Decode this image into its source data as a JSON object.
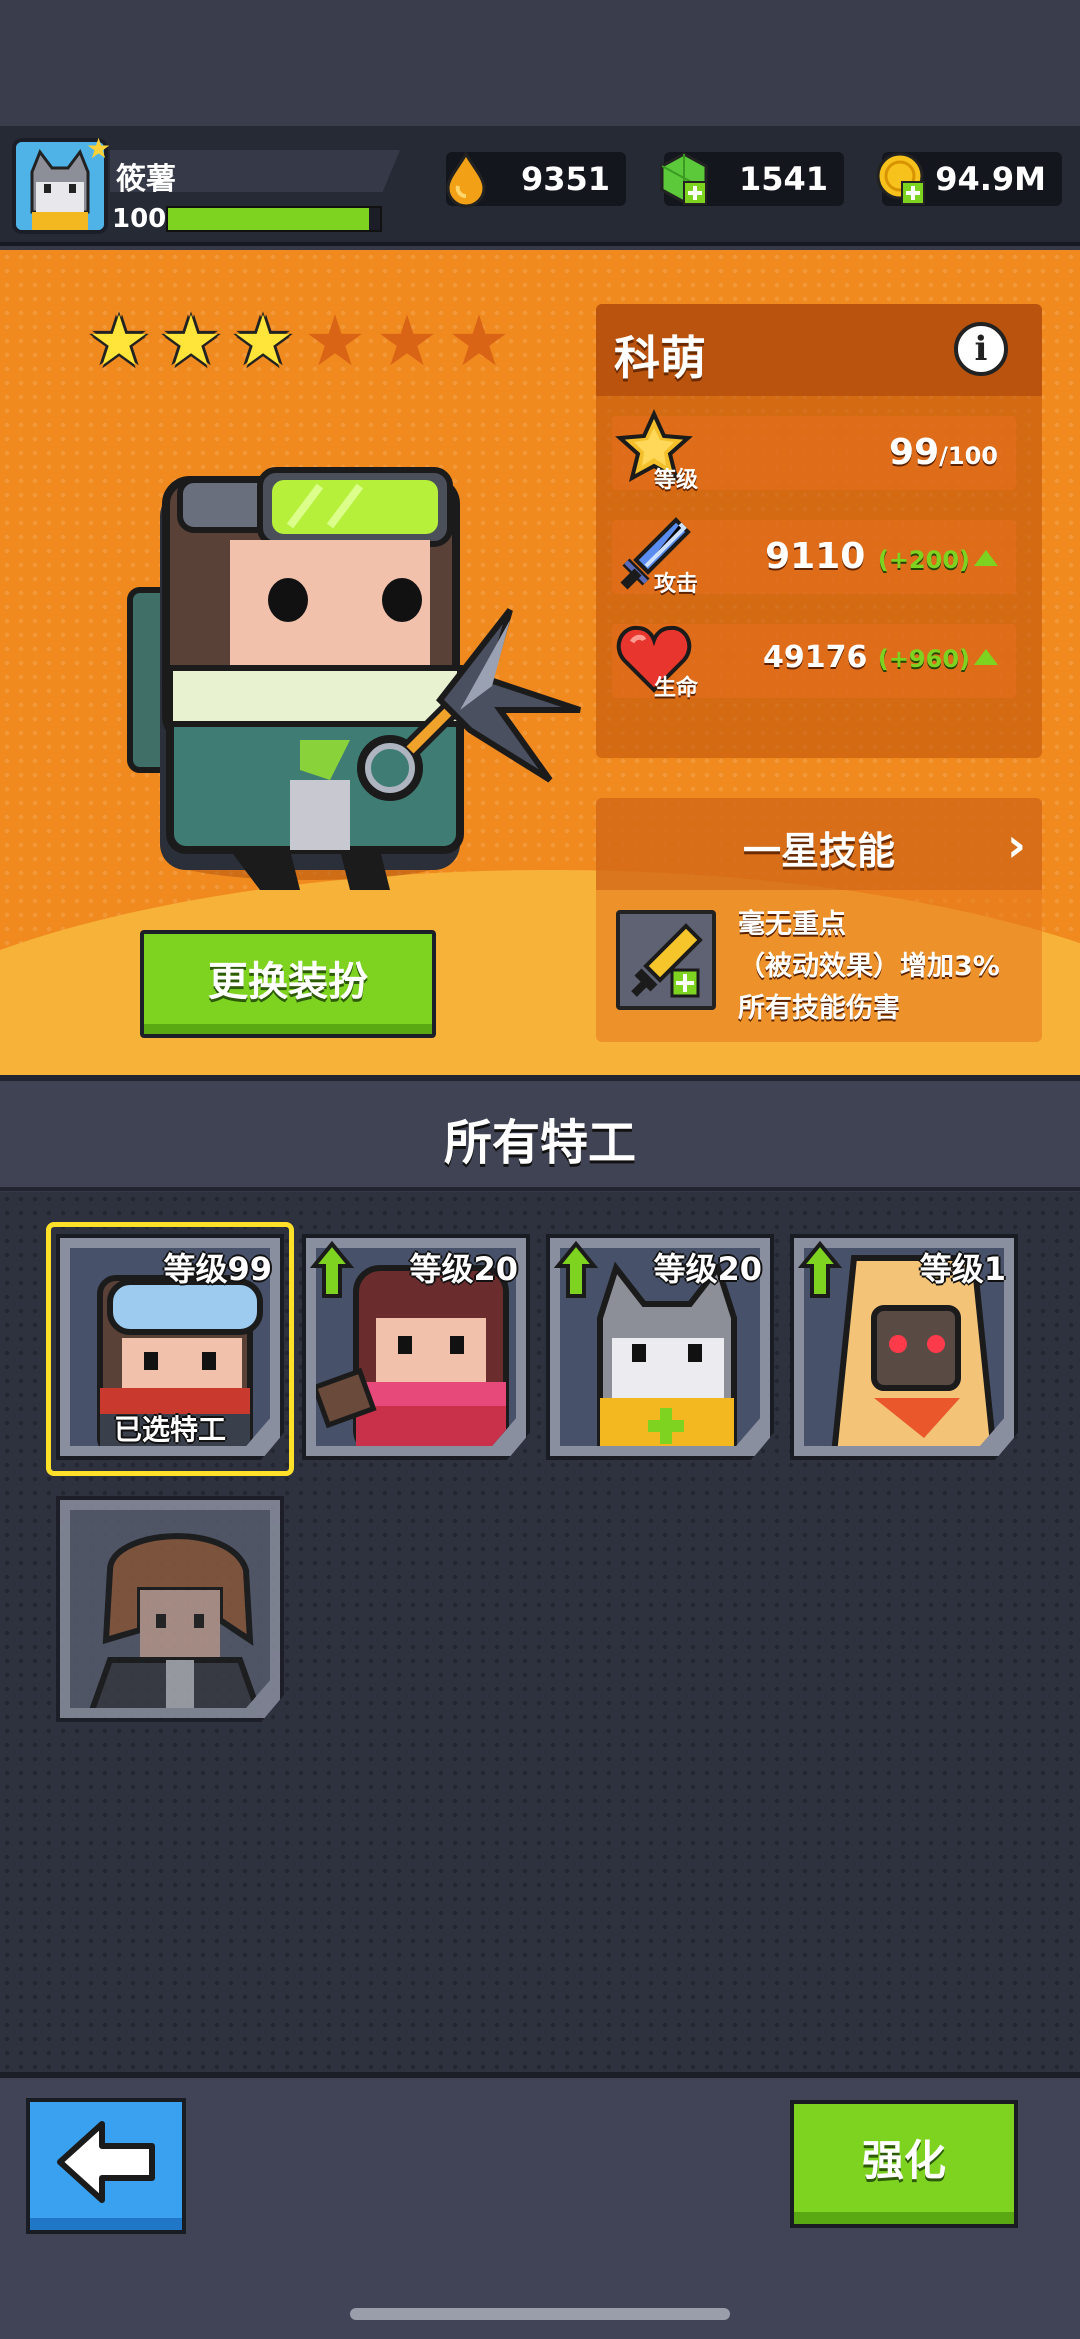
{
  "player": {
    "name": "筱薯",
    "level": "100",
    "xp_fraction": 0.95
  },
  "currencies": [
    {
      "icon": "fuel-drop-icon",
      "value": "9351"
    },
    {
      "icon": "green-gem-icon",
      "value": "1541"
    },
    {
      "icon": "gold-coin-icon",
      "value": "94.9M"
    }
  ],
  "hero": {
    "stars_total": 6,
    "stars_filled": 3,
    "change_outfit_label": "更换装扮"
  },
  "agent": {
    "name": "科萌",
    "info_label": "i",
    "stats": {
      "level": {
        "label": "等级",
        "value": "99",
        "max": "/100"
      },
      "attack": {
        "label": "攻击",
        "value": "9110",
        "bonus": "(+200)"
      },
      "health": {
        "label": "生命",
        "value": "49176",
        "bonus": "(+960)"
      }
    }
  },
  "skill": {
    "title": "一星技能",
    "chevron": "›",
    "name": "毫无重点",
    "line2": "（被动效果）增加3%",
    "line3": "所有技能伤害"
  },
  "roster": {
    "title": "所有特工",
    "cards": [
      {
        "level": "等级99",
        "selected_label": "已选特工",
        "upgrade": false
      },
      {
        "level": "等级20",
        "upgrade": true
      },
      {
        "level": "等级20",
        "upgrade": true
      },
      {
        "level": "等级1",
        "upgrade": true
      },
      {
        "level": "",
        "upgrade": false
      }
    ]
  },
  "bottom": {
    "enhance_label": "强化"
  },
  "colors": {
    "accent_green": "#7ed321",
    "hero_orange": "#f08a1e",
    "selected_frame": "#ffe12a",
    "back_blue": "#3aa0f0"
  }
}
